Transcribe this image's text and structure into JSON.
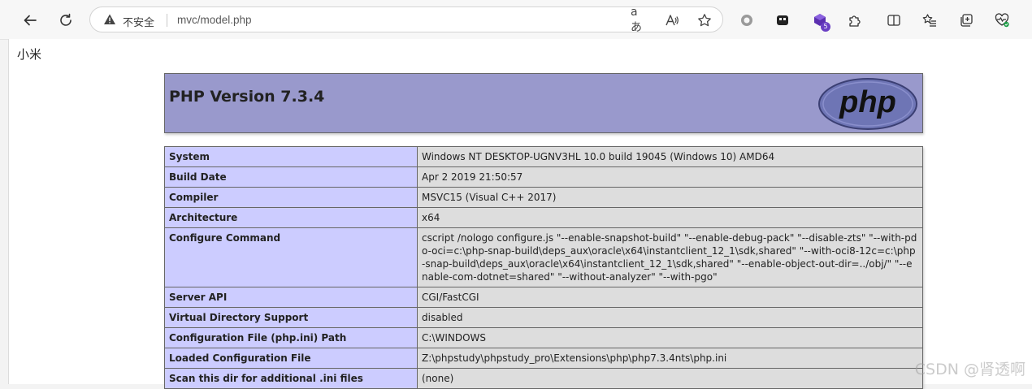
{
  "browser": {
    "security_label": "不安全",
    "url": "mvc/model.php",
    "read_aloud_label": "aあ",
    "extension_badge": "5"
  },
  "icons": {
    "back": "back-arrow-icon",
    "refresh": "refresh-icon",
    "warning": "warning-icon",
    "translate": "translate-icon",
    "read_aloud": "read-aloud-icon",
    "favorite": "star-icon",
    "record": "record-icon",
    "extension_dark": "extension-icon",
    "extension_purple": "extension-purple-icon",
    "extensions": "puzzle-icon",
    "split_screen": "split-screen-icon",
    "favorites": "favorites-list-icon",
    "collections": "collections-icon",
    "performance": "heart-pulse-icon"
  },
  "page": {
    "echo_text": "小米",
    "php_title": "PHP Version 7.3.4",
    "php_logo_text": "php",
    "rows": [
      {
        "key": "System",
        "value": "Windows NT DESKTOP-UGNV3HL 10.0 build 19045 (Windows 10) AMD64"
      },
      {
        "key": "Build Date",
        "value": "Apr 2 2019 21:50:57"
      },
      {
        "key": "Compiler",
        "value": "MSVC15 (Visual C++ 2017)"
      },
      {
        "key": "Architecture",
        "value": "x64"
      },
      {
        "key": "Configure Command",
        "value": "cscript /nologo configure.js \"--enable-snapshot-build\" \"--enable-debug-pack\" \"--disable-zts\" \"--with-pdo-oci=c:\\php-snap-build\\deps_aux\\oracle\\x64\\instantclient_12_1\\sdk,shared\" \"--with-oci8-12c=c:\\php-snap-build\\deps_aux\\oracle\\x64\\instantclient_12_1\\sdk,shared\" \"--enable-object-out-dir=../obj/\" \"--enable-com-dotnet=shared\" \"--without-analyzer\" \"--with-pgo\""
      },
      {
        "key": "Server API",
        "value": "CGI/FastCGI"
      },
      {
        "key": "Virtual Directory Support",
        "value": "disabled"
      },
      {
        "key": "Configuration File (php.ini) Path",
        "value": "C:\\WINDOWS"
      },
      {
        "key": "Loaded Configuration File",
        "value": "Z:\\phpstudy\\phpstudy_pro\\Extensions\\php\\php7.3.4nts\\php.ini"
      },
      {
        "key": "Scan this dir for additional .ini files",
        "value": "(none)"
      }
    ]
  },
  "watermark": "CSDN @肾透啊",
  "colors": {
    "header_bg": "#9999cc",
    "key_cell_bg": "#ccccff",
    "value_cell_bg": "#dddddd",
    "logo_bg": "#6e75b5"
  }
}
